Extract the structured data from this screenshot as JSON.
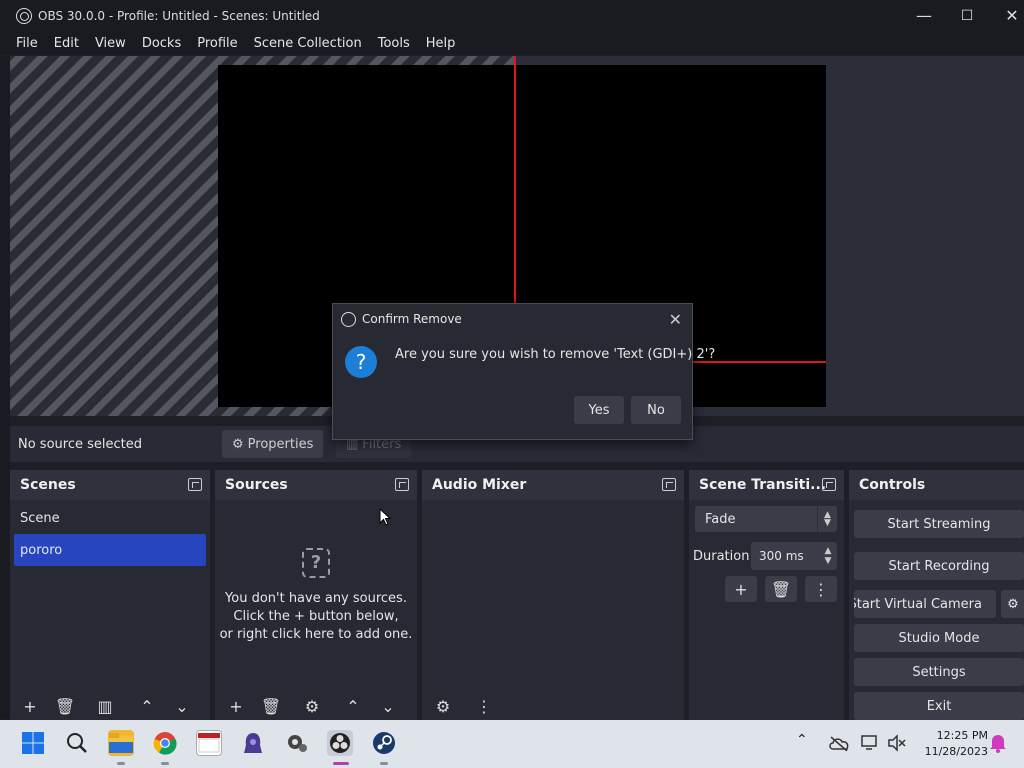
{
  "window": {
    "title": "OBS 30.0.0 - Profile: Untitled - Scenes: Untitled",
    "minimize": "—",
    "maximize": "☐",
    "close": "✕"
  },
  "menu": [
    "File",
    "Edit",
    "View",
    "Docks",
    "Profile",
    "Scene Collection",
    "Tools",
    "Help"
  ],
  "source_toolbar": {
    "status": "No source selected",
    "properties": "Properties",
    "filters": "Filters"
  },
  "scenes": {
    "title": "Scenes",
    "items": [
      "Scene",
      "pororo"
    ],
    "selected": "pororo"
  },
  "sources": {
    "title": "Sources",
    "empty_line1": "You don't have any sources.",
    "empty_line2": "Click the + button below,",
    "empty_line3": "or right click here to add one."
  },
  "audio_mixer": {
    "title": "Audio Mixer"
  },
  "transitions": {
    "title": "Scene Transiti...",
    "selected": "Fade",
    "duration_label": "Duration",
    "duration_value": "300 ms"
  },
  "controls": {
    "title": "Controls",
    "start_streaming": "Start Streaming",
    "start_recording": "Start Recording",
    "start_virtual_camera": "Start Virtual Camera",
    "studio_mode": "Studio Mode",
    "settings": "Settings",
    "exit": "Exit"
  },
  "dialog": {
    "title": "Confirm Remove",
    "message": "Are you sure you wish to remove 'Text (GDI+) 2'?",
    "yes": "Yes",
    "no": "No"
  },
  "taskbar": {
    "time": "12:25 PM",
    "date": "11/28/2023"
  },
  "colors": {
    "accent": "#2845c0",
    "preview_guide": "#e0141e",
    "question_icon": "#1d7ed8"
  }
}
